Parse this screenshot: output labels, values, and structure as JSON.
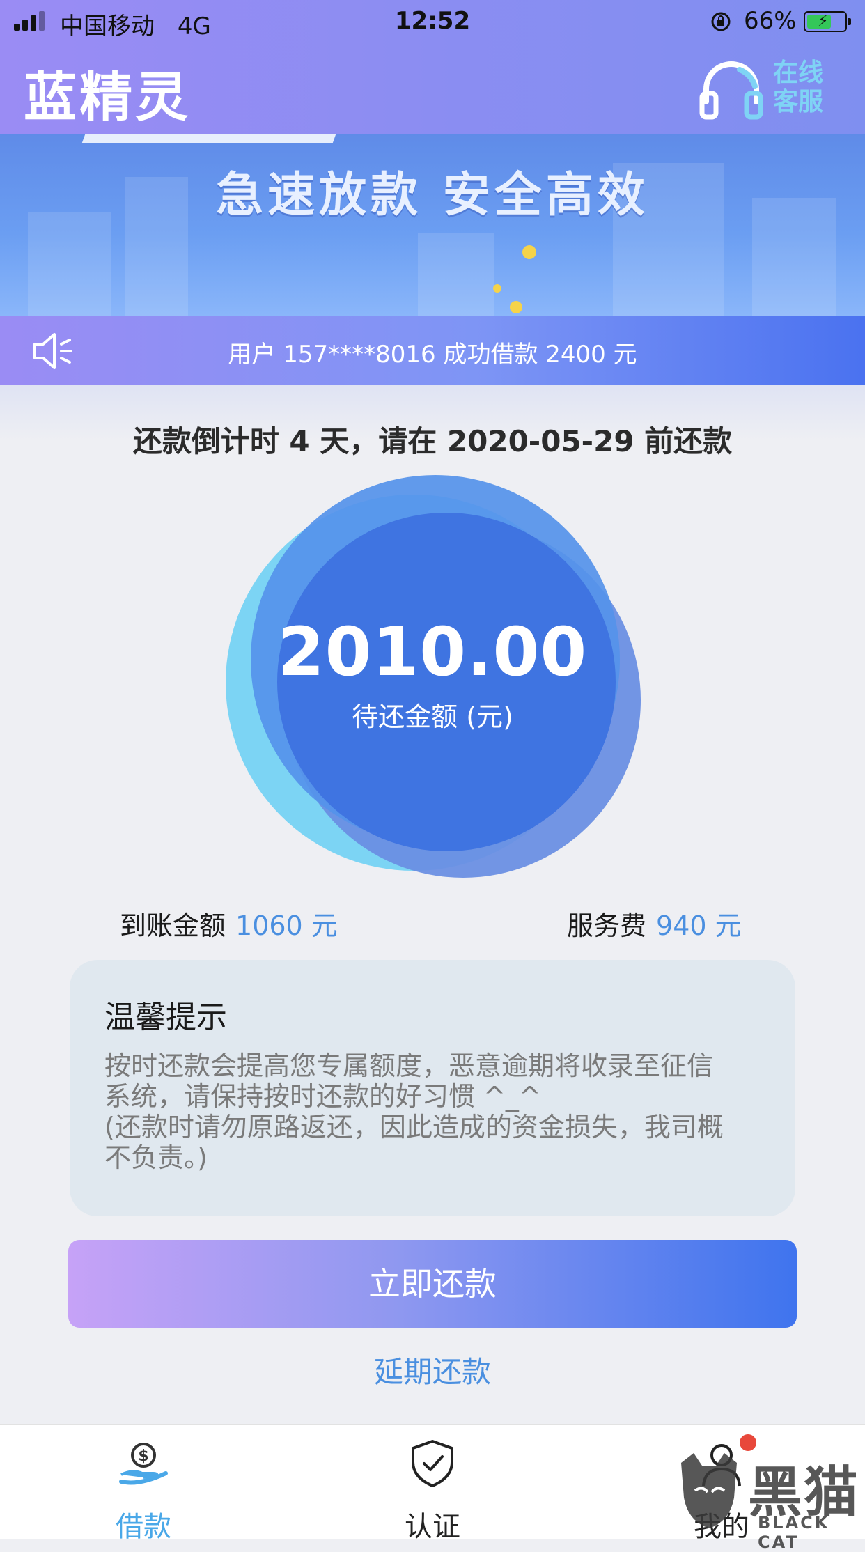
{
  "status_bar": {
    "carrier": "中国移动",
    "network": "4G",
    "time": "12:52",
    "battery_pct": "66%",
    "battery_level": 0.66
  },
  "app": {
    "title": "蓝精灵",
    "support_label": "在线客服",
    "support_icon": "headset-icon"
  },
  "banner": {
    "text": "急速放款  安全高效"
  },
  "marquee": {
    "icon": "speaker-icon",
    "text": "用户 157****8016 成功借款 2400 元"
  },
  "countdown": {
    "text": "还款倒计时 4 天，请在 2020-05-29 前还款"
  },
  "loan": {
    "amount": "2010.00",
    "amount_label": "待还金额 (元)",
    "received_label": "到账金额",
    "received_value": "1060 元",
    "fee_label": "服务费",
    "fee_value": "940 元"
  },
  "tip": {
    "title": "温馨提示",
    "body": "按时还款会提高您专属额度，恶意逾期将收录至征信\n系统，请保持按时还款的好习惯 ^_^\n(还款时请勿原路返还，因此造成的资金损失，我司概\n不负责。)"
  },
  "actions": {
    "repay_label": "立即还款",
    "extend_label": "延期还款"
  },
  "tabs": [
    {
      "label": "借款",
      "icon": "money-hand-icon",
      "active": true
    },
    {
      "label": "认证",
      "icon": "shield-check-icon",
      "active": false
    },
    {
      "label": "我的",
      "icon": "user-icon",
      "active": false
    }
  ],
  "watermark": {
    "cn": "黑猫",
    "en": "BLACK CAT"
  },
  "colors": {
    "accent_blue": "#4a8fe0",
    "active_tab": "#4aa8e8",
    "badge_red": "#e8483b"
  }
}
